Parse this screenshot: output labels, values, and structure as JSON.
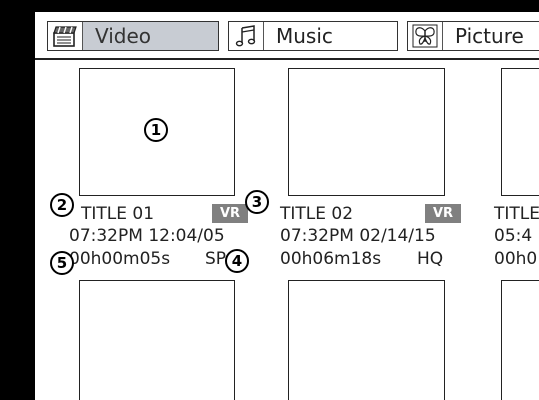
{
  "tabs": [
    {
      "label": "Video",
      "icon": "clapperboard-icon",
      "active": true
    },
    {
      "label": "Music",
      "icon": "music-note-icon",
      "active": false
    },
    {
      "label": "Picture",
      "icon": "butterfly-icon",
      "active": false
    }
  ],
  "items": [
    {
      "title": "TITLE 01",
      "badge": "VR",
      "datetime": "07:32PM 12:04/05",
      "duration": "00h00m05s",
      "quality": "SP"
    },
    {
      "title": "TITLE 02",
      "badge": "VR",
      "datetime": "07:32PM 02/14/15",
      "duration": "00h06m18s",
      "quality": "HQ"
    },
    {
      "title": "TITLE",
      "datetime": "05:4",
      "duration": "00h0"
    }
  ],
  "callouts": [
    "1",
    "2",
    "3",
    "4",
    "5"
  ],
  "colors": {
    "active_tab": "#c8ccd3",
    "badge": "#808080",
    "frame": "#000000"
  }
}
